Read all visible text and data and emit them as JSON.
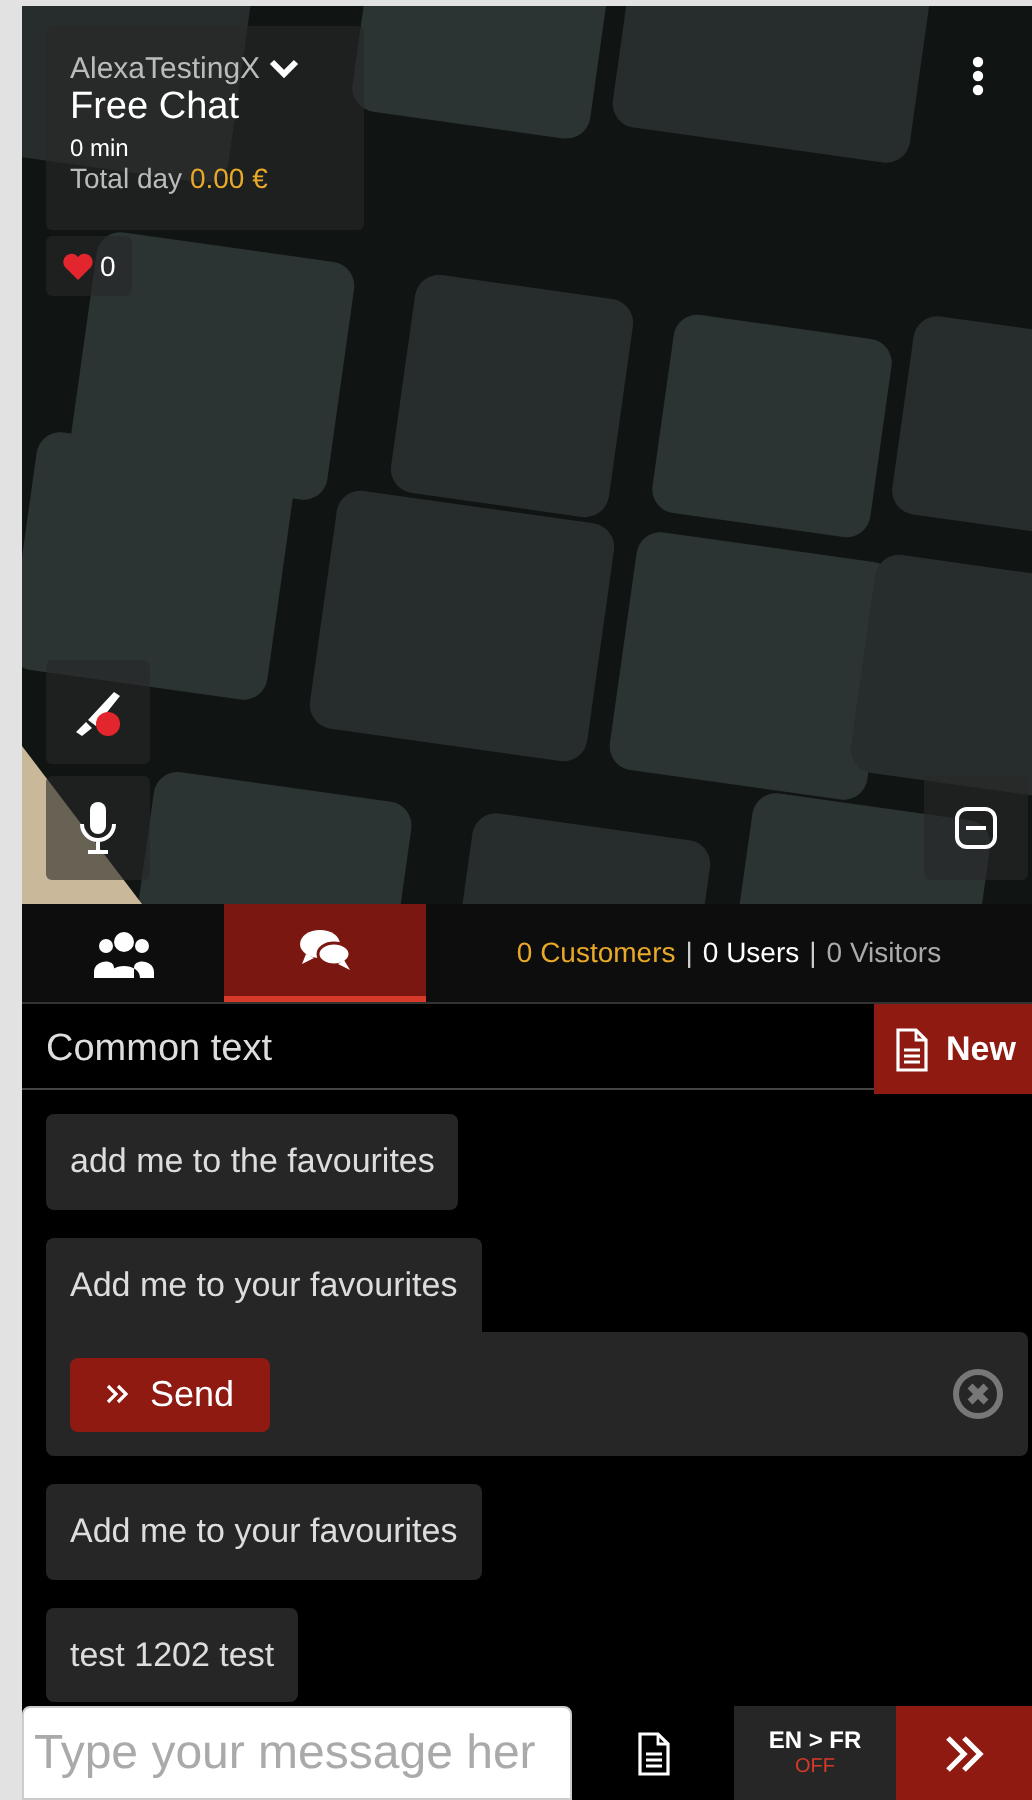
{
  "header": {
    "username": "AlexaTestingX",
    "mode": "Free Chat",
    "duration": "0 min",
    "total_label": "Total day",
    "total_value": "0.00 €"
  },
  "likes": {
    "count": "0"
  },
  "tabs": [
    {
      "kind": "users",
      "selected": false
    },
    {
      "kind": "chat",
      "selected": true
    }
  ],
  "audience": [
    {
      "kind": "customers",
      "text": "0 Customers"
    },
    {
      "kind": "users",
      "separator": "|",
      "text": "0 Users"
    },
    {
      "kind": "visitors",
      "separator": "|",
      "text": "0 Visitors"
    }
  ],
  "common_text": {
    "title": "Common text",
    "new_button": "New"
  },
  "messages": [
    {
      "text": "add me to the favourites",
      "expanded": false
    },
    {
      "text": "Add me to your favourites",
      "expanded": true,
      "send_label": "Send"
    },
    {
      "text": "Add me to your favourites",
      "expanded": false
    },
    {
      "text": "test 1202 test",
      "expanded": false
    }
  ],
  "composer": {
    "placeholder": "Type your message her",
    "translate": {
      "label": "EN > FR",
      "state": "OFF",
      "on": false
    }
  }
}
